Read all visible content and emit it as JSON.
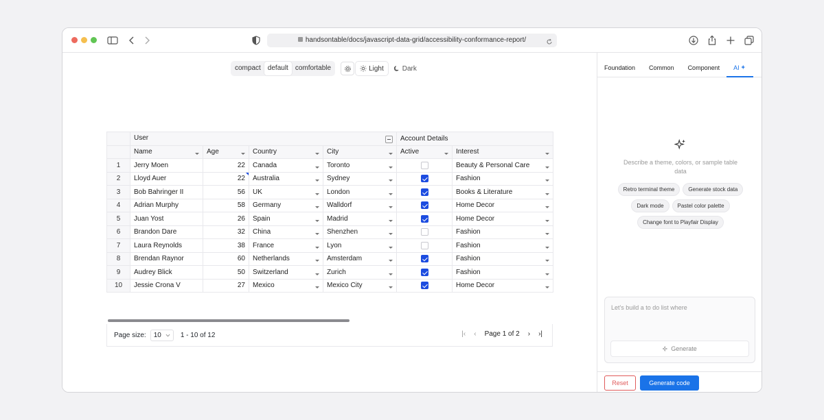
{
  "browser": {
    "url": "handsontable/docs/javascript-data-grid/accessibility-conformance-report/",
    "colors": {
      "close": "#ed6a5e",
      "minimize": "#f5bf4f",
      "maximize": "#61c554"
    }
  },
  "toolbar": {
    "density": [
      "compact",
      "default",
      "comfortable"
    ],
    "density_selected": "default",
    "theme_light": "Light",
    "theme_dark": "Dark"
  },
  "grid": {
    "group_headers": {
      "user": "User",
      "account": "Account Details"
    },
    "columns": [
      "Name",
      "Age",
      "Country",
      "City",
      "Active",
      "Interest"
    ],
    "rows": [
      {
        "n": "1",
        "name": "Jerry Moen",
        "age": "22",
        "country": "Canada",
        "city": "Toronto",
        "active": false,
        "interest": "Beauty & Personal Care"
      },
      {
        "n": "2",
        "name": "Lloyd Auer",
        "age": "22",
        "country": "Australia",
        "city": "Sydney",
        "active": true,
        "interest": "Fashion"
      },
      {
        "n": "3",
        "name": "Bob Bahringer II",
        "age": "56",
        "country": "UK",
        "city": "London",
        "active": true,
        "interest": "Books & Literature"
      },
      {
        "n": "4",
        "name": "Adrian Murphy",
        "age": "58",
        "country": "Germany",
        "city": "Walldorf",
        "active": true,
        "interest": "Home Decor"
      },
      {
        "n": "5",
        "name": "Juan Yost",
        "age": "26",
        "country": "Spain",
        "city": "Madrid",
        "active": true,
        "interest": "Home Decor"
      },
      {
        "n": "6",
        "name": "Brandon Dare",
        "age": "32",
        "country": "China",
        "city": "Shenzhen",
        "active": false,
        "interest": "Fashion"
      },
      {
        "n": "7",
        "name": "Laura Reynolds",
        "age": "38",
        "country": "France",
        "city": "Lyon",
        "active": false,
        "interest": "Fashion"
      },
      {
        "n": "8",
        "name": "Brendan Raynor",
        "age": "60",
        "country": "Netherlands",
        "city": "Amsterdam",
        "active": true,
        "interest": "Fashion"
      },
      {
        "n": "9",
        "name": "Audrey Blick",
        "age": "50",
        "country": "Switzerland",
        "city": "Zurich",
        "active": true,
        "interest": "Fashion"
      },
      {
        "n": "10",
        "name": "Jessie Crona V",
        "age": "27",
        "country": "Mexico",
        "city": "Mexico City",
        "active": true,
        "interest": "Home Decor"
      }
    ]
  },
  "pager": {
    "size_label": "Page size:",
    "size_value": "10",
    "range": "1 - 10 of 12",
    "page_text": "Page 1 of 2"
  },
  "side": {
    "tabs": [
      "Foundation",
      "Common",
      "Component",
      "AI"
    ],
    "active_tab": "AI",
    "description": "Describe a theme, colors, or sample table data",
    "chips": [
      "Retro terminal theme",
      "Generate stock data",
      "Dark mode",
      "Pastel color palette",
      "Change font to Playfair Display"
    ],
    "prompt_placeholder": "Let's build a to do list where",
    "generate_label": "Generate",
    "reset_label": "Reset",
    "generate_code_label": "Generate code",
    "accent": "#1a73e8"
  }
}
